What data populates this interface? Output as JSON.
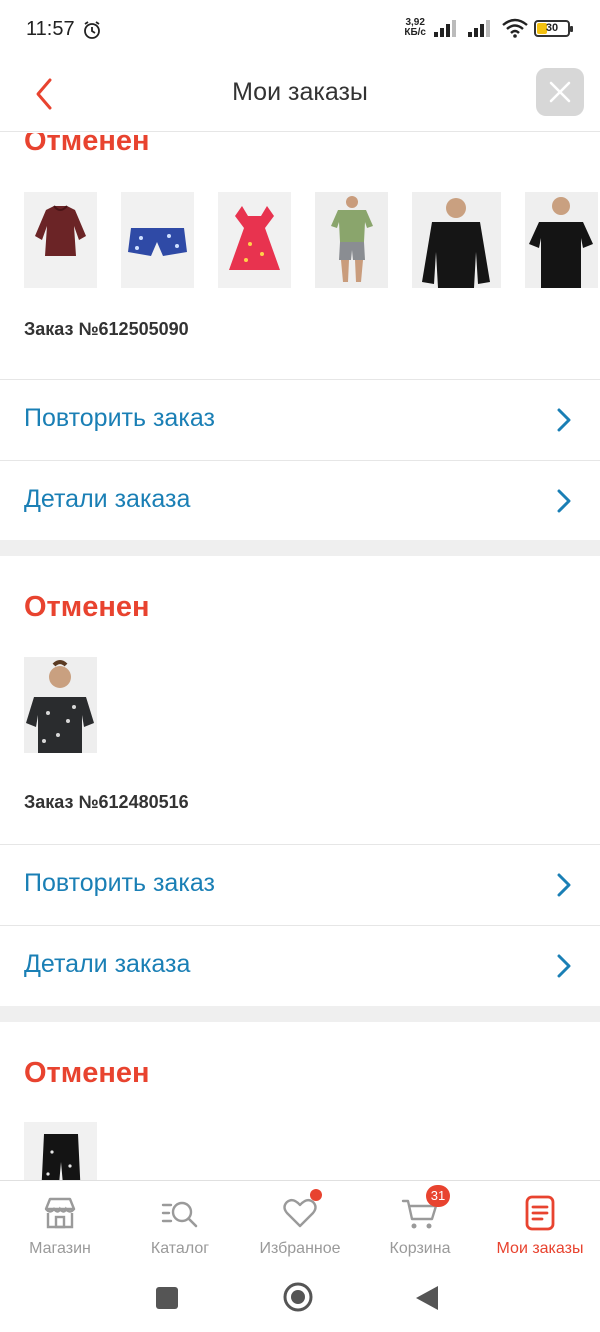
{
  "status_bar": {
    "time": "11:57",
    "net_speed_value": "3,92",
    "net_speed_unit": "КБ/с",
    "battery": "30",
    "battery_level": 0.3
  },
  "header": {
    "title": "Мои заказы"
  },
  "orders": [
    {
      "status": "Отменен",
      "number": "Заказ №612505090",
      "repeat_label": "Повторить заказ",
      "details_label": "Детали заказа"
    },
    {
      "status": "Отменен",
      "number": "Заказ №612480516",
      "repeat_label": "Повторить заказ",
      "details_label": "Детали заказа"
    },
    {
      "status": "Отменен"
    }
  ],
  "bottom_nav": [
    {
      "label": "Магазин",
      "icon": "store-icon"
    },
    {
      "label": "Каталог",
      "icon": "catalog-search-icon"
    },
    {
      "label": "Избранное",
      "icon": "heart-icon"
    },
    {
      "label": "Корзина",
      "icon": "cart-icon",
      "badge": "31"
    },
    {
      "label": "Мои заказы",
      "icon": "orders-list-icon",
      "active": true
    }
  ],
  "colors": {
    "accent_red": "#e8432f",
    "link_blue": "#1a7fb5",
    "inactive_gray": "#9a9a9a"
  }
}
